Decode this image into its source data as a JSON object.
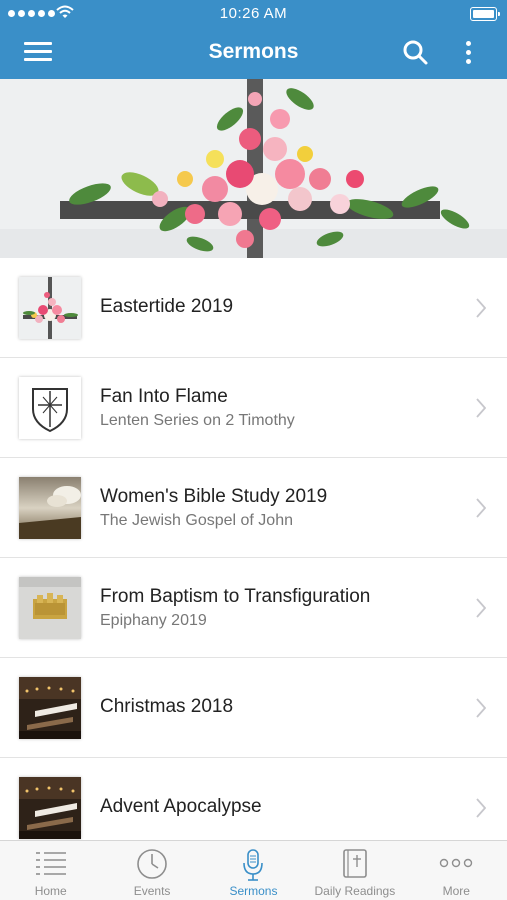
{
  "status_bar": {
    "time": "10:26 AM"
  },
  "nav": {
    "title": "Sermons",
    "menu_icon": "hamburger-menu-icon",
    "search_icon": "search-icon",
    "more_icon": "vertical-ellipsis-icon"
  },
  "hero": {
    "image": "floral-cross-photo"
  },
  "series": [
    {
      "title": "Eastertide 2019",
      "subtitle": "",
      "thumbnail": "floral-cross-thumbnail"
    },
    {
      "title": "Fan Into Flame",
      "subtitle": "Lenten Series on 2 Timothy",
      "thumbnail": "shield-emblem-thumbnail"
    },
    {
      "title": "Women's Bible Study 2019",
      "subtitle": "The Jewish Gospel of John",
      "thumbnail": "sky-landscape-thumbnail"
    },
    {
      "title": "From Baptism to Transfiguration",
      "subtitle": "Epiphany 2019",
      "thumbnail": "gold-altar-thumbnail"
    },
    {
      "title": "Christmas 2018",
      "subtitle": "",
      "thumbnail": "candlelit-church-thumbnail"
    },
    {
      "title": "Advent Apocalypse",
      "subtitle": "",
      "thumbnail": "candlelit-church-thumbnail"
    }
  ],
  "tabs": [
    {
      "label": "Home",
      "icon": "list-icon",
      "active": false
    },
    {
      "label": "Events",
      "icon": "clock-icon",
      "active": false
    },
    {
      "label": "Sermons",
      "icon": "microphone-icon",
      "active": true
    },
    {
      "label": "Daily Readings",
      "icon": "bible-icon",
      "active": false
    },
    {
      "label": "More",
      "icon": "more-dots-icon",
      "active": false
    }
  ],
  "colors": {
    "accent": "#3a8fc8",
    "tab_inactive": "#8e8e8e",
    "subtitle": "#777777"
  }
}
